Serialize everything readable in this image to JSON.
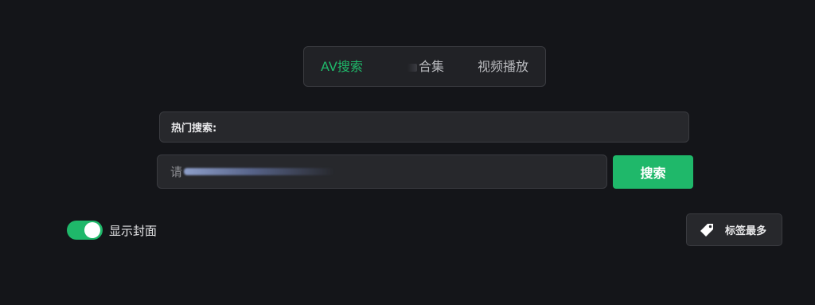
{
  "tabs": [
    {
      "label": "AV搜索",
      "active": true
    },
    {
      "label": "合集",
      "active": false
    },
    {
      "label": "视频播放",
      "active": false
    }
  ],
  "hot_search": {
    "label": "热门搜索:"
  },
  "search": {
    "placeholder_prefix": "请",
    "button_label": "搜索"
  },
  "toggle": {
    "label": "显示封面",
    "on": true
  },
  "tag_button": {
    "label": "标签最多",
    "icon": "tag-icon"
  },
  "colors": {
    "accent": "#1fb86a",
    "background": "#141519",
    "panel": "#27282c",
    "border": "#3a3b40"
  }
}
